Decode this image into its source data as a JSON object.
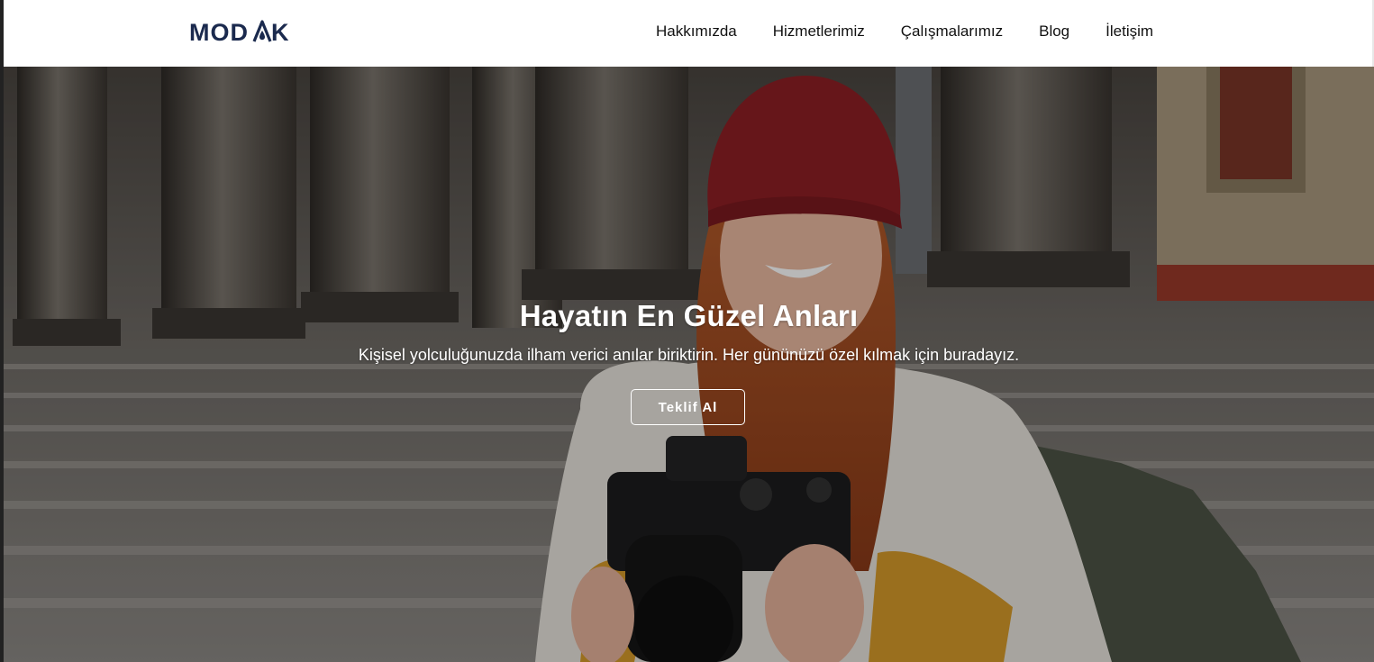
{
  "brand": {
    "logo_text": "MODAK",
    "logo_color": "#1b2a4e"
  },
  "nav": {
    "items": [
      "Hakkımızda",
      "Hizmetlerimiz",
      "Çalışmalarımız",
      "Blog",
      "İletişim"
    ]
  },
  "hero": {
    "title": "Hayatın En Güzel Anları",
    "subtitle": "Kişisel yolculuğunuzda ilham verici anılar biriktirin. Her gününüzü özel kılmak için buradayız.",
    "cta_label": "Teklif Al"
  }
}
